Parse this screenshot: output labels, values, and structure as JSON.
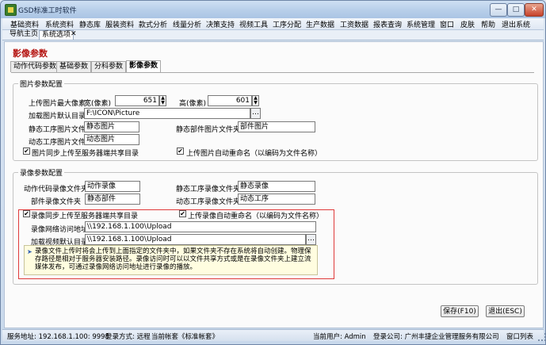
{
  "window": {
    "title": "GSD标准工时软件",
    "min_label": "—",
    "max_label": "□",
    "close_label": "✕"
  },
  "menu": [
    "基础资料",
    "系统资料",
    "静态库",
    "服装资料",
    "款式分析",
    "线量分析",
    "决策支持",
    "视频工具",
    "工序分配",
    "生产数据",
    "工资数据",
    "报表查询",
    "系统管理",
    "窗口",
    "皮肤",
    "帮助",
    "退出系统"
  ],
  "doc_tabs": {
    "home": "导航主页",
    "options": "系统选项",
    "close_icon": "✕"
  },
  "page": {
    "title": "影像参数",
    "subtabs": [
      "动作代码参数",
      "基础参数",
      "分科参数",
      "影像参数"
    ],
    "active_subtab": 3
  },
  "image_config": {
    "legend": "图片参数配置",
    "max_pixels_label": "上传图片最大像素",
    "width_label": "宽(像素)",
    "width_value": "651",
    "height_label": "高(像素)",
    "height_value": "601",
    "load_dir_label": "加载图片默认目录",
    "load_dir_value": "F:\\ICON\\Picture",
    "browse_label": "…",
    "static_process_label": "静态工序图片文件夹",
    "static_process_value": "静态图片",
    "static_part_label": "静态部件图片文件夹",
    "static_part_value": "部件图片",
    "dynamic_process_label": "动态工序图片文件夹",
    "dynamic_process_value": "动态图片",
    "sync_label": "图片同步上传至服务器端共享目录",
    "sync_checked": true,
    "rename_label": "上传图片自动重命名（以编码为文件名称）",
    "rename_checked": true
  },
  "video_config": {
    "legend": "录像参数配置",
    "action_code_label": "动作代码录像文件夹",
    "action_code_value": "动作录像",
    "static_process_label": "静态工序录像文件夹",
    "static_process_value": "静态录像",
    "part_label": "部件录像文件夹",
    "part_value": "静态部件",
    "dynamic_process_label": "动态工序录像文件夹",
    "dynamic_process_value": "动态工序",
    "sync_label": "录像同步上传至服务器端共享目录",
    "sync_checked": true,
    "rename_label": "上传录像自动重命名（以编码为文件名称）",
    "rename_checked": true,
    "network_url_label": "录像网络访问地址",
    "network_url_value": "\\\\192.168.1.100\\Upload",
    "load_dir_label": "加载视频默认目录",
    "load_dir_value": "\\\\192.168.1.100\\Upload",
    "browse_label": "…",
    "info_text": "录像文件上传时将会上传到上面指定的文件夹中，如果文件夹不存在系统将自动创建。物理保存路径是相对于服务器安装路径。录像访问时可以以文件共享方式或是在录像文件夹上建立流媒体发布，可通过录像网络访问地址进行录像的播放。"
  },
  "buttons": {
    "save": "保存(F10)",
    "exit": "退出(ESC)"
  },
  "status": {
    "server": "服务地址: 192.168.1.100: 9998",
    "login_mode": "登录方式: 远程",
    "account": "当前帐套《标准帐套》",
    "user": "当前用户:  Admin",
    "company": "登录公司: 广州丰捷企业管理服务有限公司",
    "window_list": "窗口列表"
  },
  "colors": {
    "page_title": "#b4120f",
    "highlight_border": "#e03a3a",
    "info_background": "#fffde0"
  }
}
